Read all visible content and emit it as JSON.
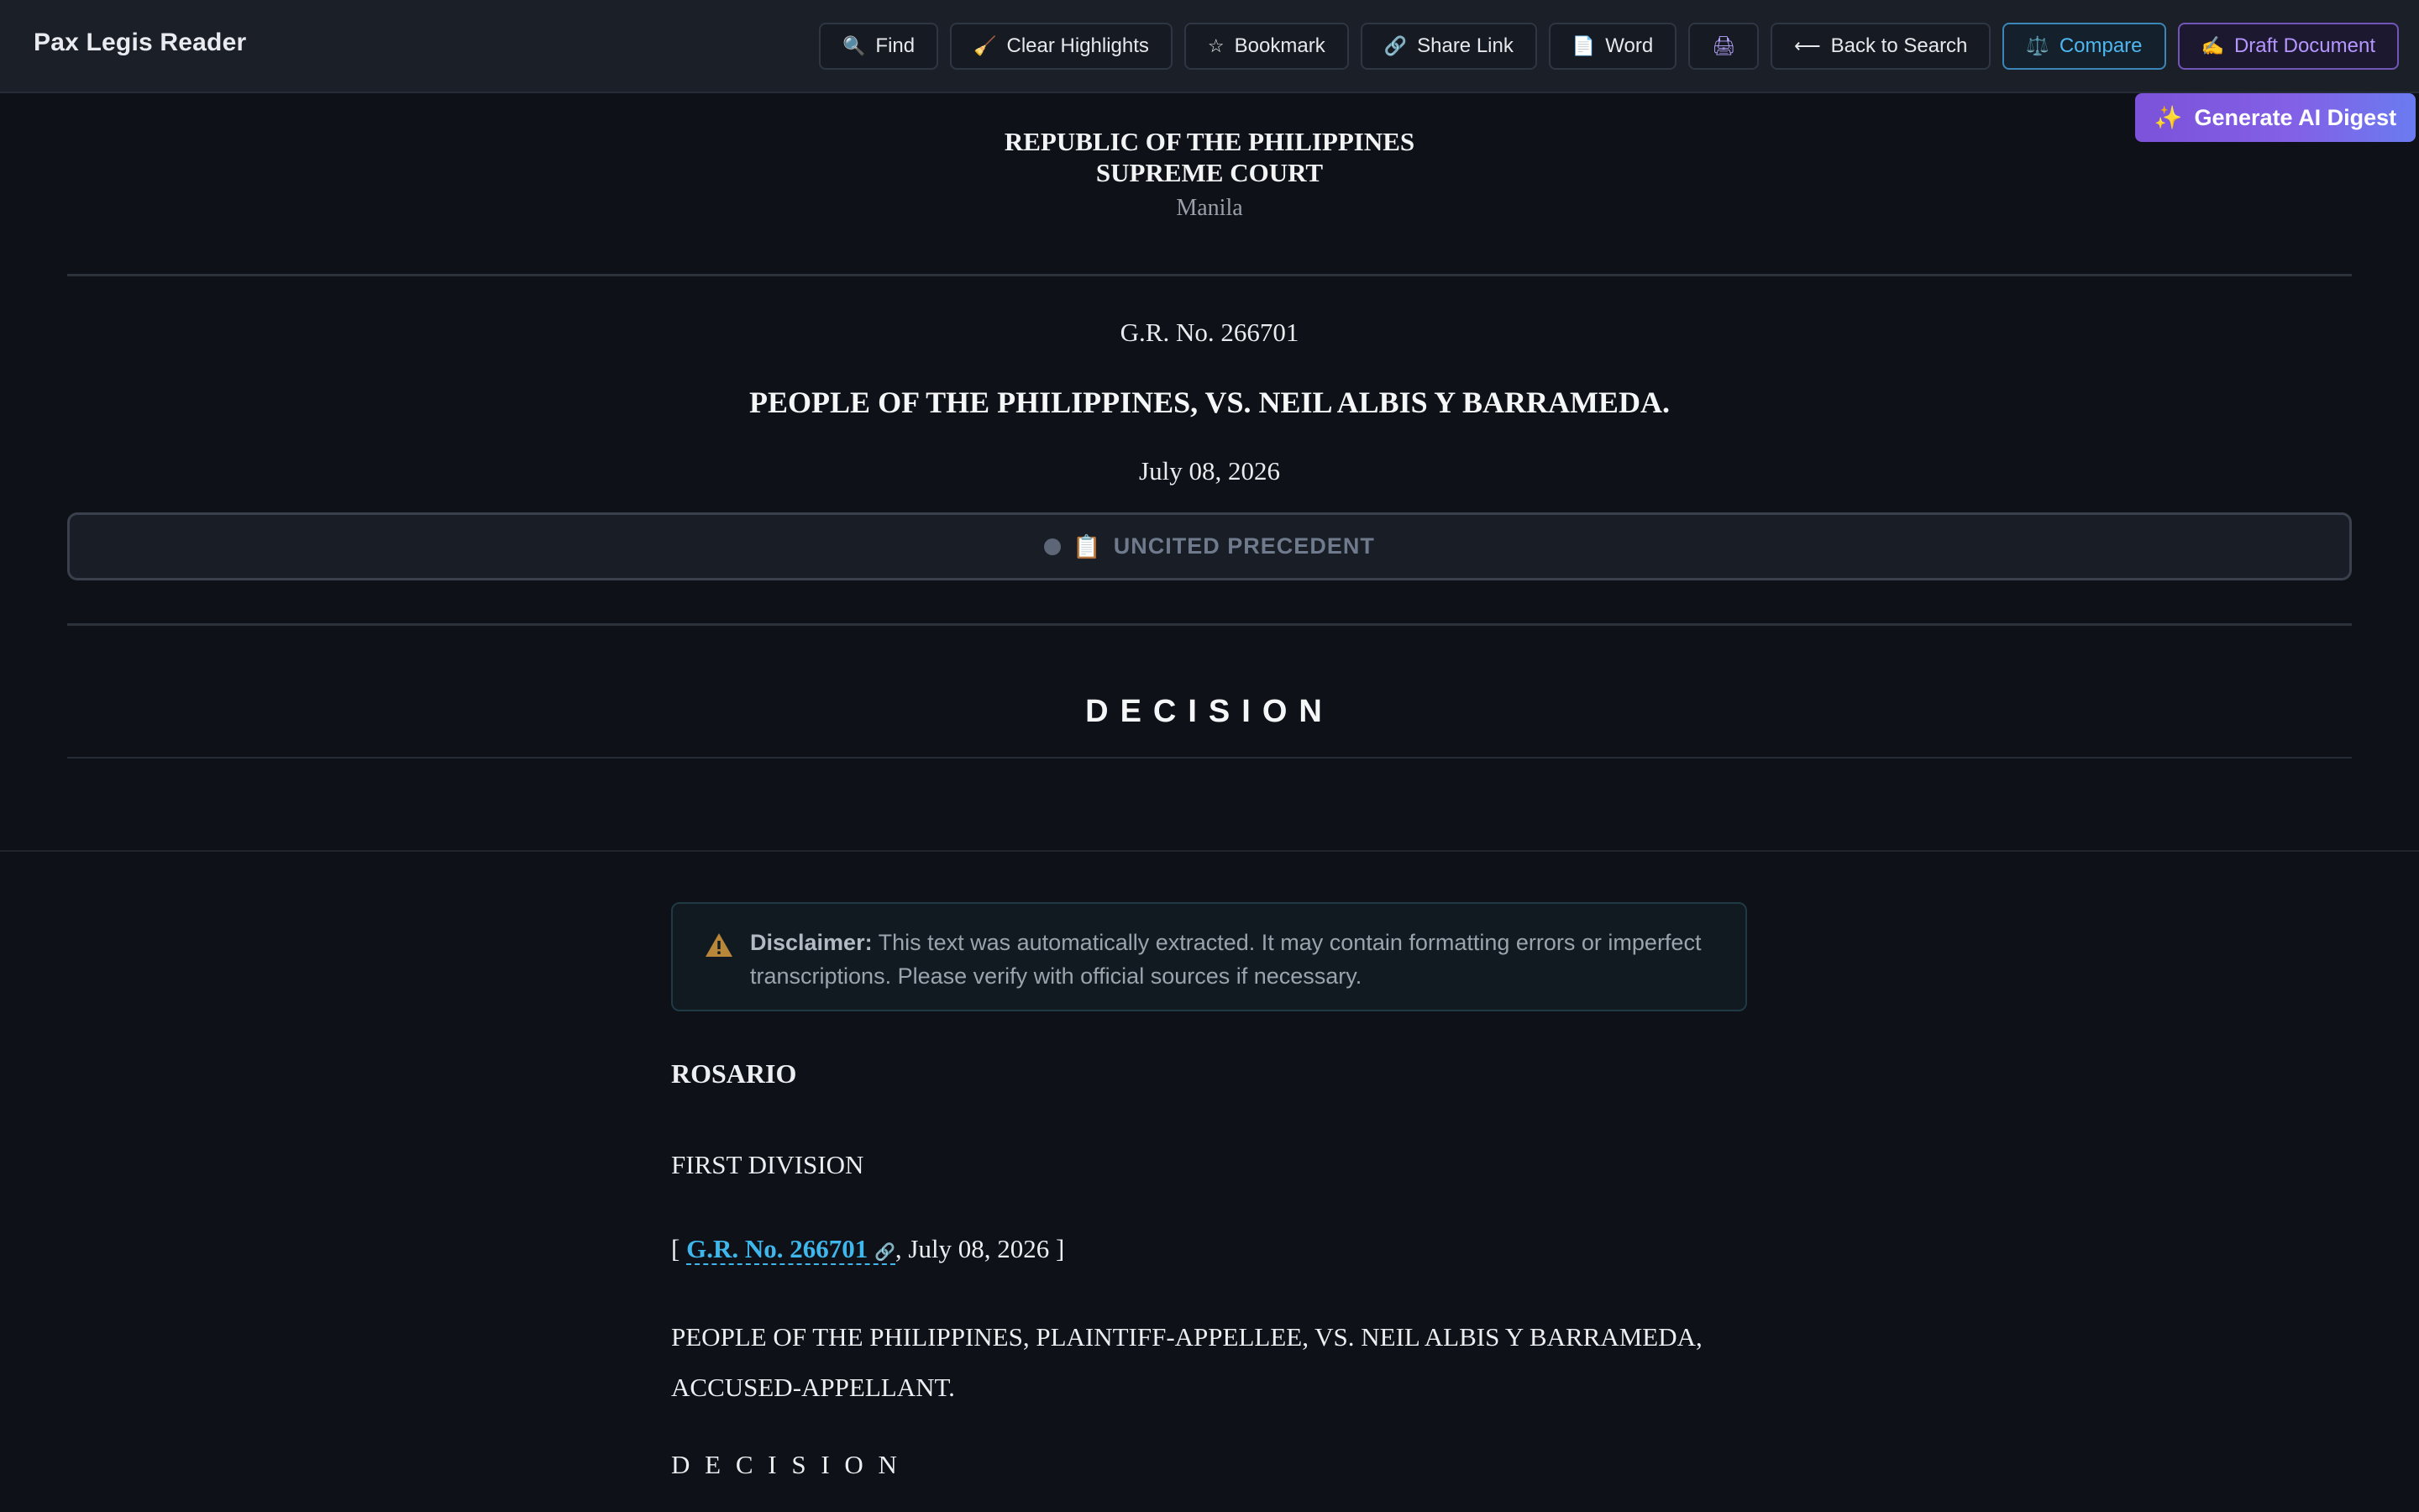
{
  "app": {
    "title": "Pax Legis Reader"
  },
  "toolbar": {
    "find": {
      "icon": "🔍",
      "label": "Find"
    },
    "clear": {
      "icon": "🧹",
      "label": "Clear Highlights"
    },
    "bookmark": {
      "icon": "☆",
      "label": "Bookmark"
    },
    "share": {
      "icon": "🔗",
      "label": "Share Link"
    },
    "word": {
      "icon": "📄",
      "label": "Word"
    },
    "print": {
      "icon": "🖨"
    },
    "back": {
      "icon": "⟵",
      "label": "Back to Search"
    },
    "compare": {
      "icon": "⚖️",
      "label": "Compare"
    },
    "draft": {
      "icon": "✍️",
      "label": "Draft Document"
    }
  },
  "ai_digest": {
    "icon": "✨",
    "label": "Generate AI Digest"
  },
  "header": {
    "republic": "REPUBLIC OF THE PHILIPPINES",
    "court": "SUPREME COURT",
    "location": "Manila",
    "gr_no": "G.R. No. 266701",
    "parties": "PEOPLE OF THE PHILIPPINES, VS. NEIL ALBIS Y BARRAMEDA.",
    "date": "July 08, 2026",
    "status_icon": "📋",
    "status": "UNCITED PRECEDENT",
    "decision_title": "DECISION"
  },
  "disclaimer": {
    "label": "Disclaimer:",
    "text": "This text was automatically extracted. It may contain formatting errors or imperfect transcriptions. Please verify with official sources if necessary."
  },
  "body": {
    "ponente": "ROSARIO",
    "division": "FIRST DIVISION",
    "citation_open": "[",
    "citation_link": "G.R. No. 266701",
    "citation_rest": ", July 08, 2026 ]",
    "caption": "PEOPLE OF THE PHILIPPINES, PLAINTIFF-APPELLEE, VS. NEIL ALBIS Y BARRAMEDA, ACCUSED-APPELLANT.",
    "decision_heading": "D E C I S I O N"
  },
  "colors": {
    "background": "#0e1117",
    "toolbar": "#1a1f28",
    "accent_link": "#3fb7ec",
    "compare": "#4fb6f0",
    "draft": "#b596ff",
    "ai_gradient_start": "#7b52d9",
    "ai_gradient_end": "#6a7bf0"
  }
}
